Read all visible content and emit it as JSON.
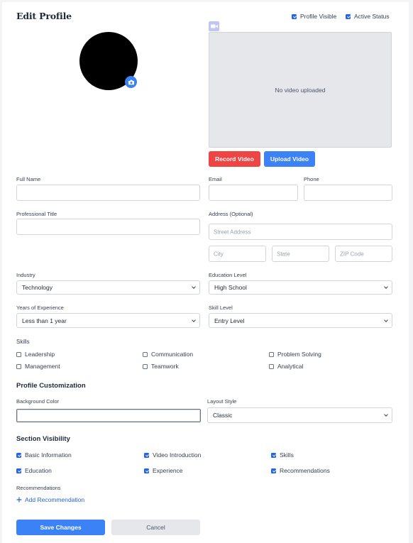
{
  "page": {
    "title": "Edit Profile"
  },
  "status": {
    "profile_visible": "Profile Visible",
    "active_status": "Active Status"
  },
  "video": {
    "empty_text": "No video uploaded",
    "record_label": "Record Video",
    "upload_label": "Upload Video"
  },
  "form": {
    "full_name": {
      "label": "Full Name",
      "value": ""
    },
    "email": {
      "label": "Email",
      "value": ""
    },
    "phone": {
      "label": "Phone",
      "value": ""
    },
    "professional_title": {
      "label": "Professional Title",
      "value": ""
    },
    "address": {
      "label": "Address (Optional)",
      "street_placeholder": "Street Address",
      "city_placeholder": "City",
      "state_placeholder": "State",
      "zip_placeholder": "ZIP Code"
    },
    "industry": {
      "label": "Industry",
      "value": "Technology"
    },
    "education_level": {
      "label": "Education Level",
      "value": "High School"
    },
    "years_experience": {
      "label": "Years of Experience",
      "value": "Less than 1 year"
    },
    "skill_level": {
      "label": "Skill Level",
      "value": "Entry Level"
    }
  },
  "skills": {
    "label": "Skills",
    "items": [
      {
        "label": "Leadership",
        "checked": false
      },
      {
        "label": "Communication",
        "checked": false
      },
      {
        "label": "Problem Solving",
        "checked": false
      },
      {
        "label": "Management",
        "checked": false
      },
      {
        "label": "Teamwork",
        "checked": false
      },
      {
        "label": "Analytical",
        "checked": false
      }
    ]
  },
  "customization": {
    "heading": "Profile Customization",
    "background_color_label": "Background Color",
    "layout_style_label": "Layout Style",
    "layout_style_value": "Classic"
  },
  "visibility": {
    "heading": "Section Visibility",
    "items": [
      {
        "label": "Basic Information",
        "checked": true
      },
      {
        "label": "Video Introduction",
        "checked": true
      },
      {
        "label": "Skills",
        "checked": true
      },
      {
        "label": "Education",
        "checked": true
      },
      {
        "label": "Experience",
        "checked": true
      },
      {
        "label": "Recommendations",
        "checked": true
      }
    ]
  },
  "recommendations": {
    "label": "Recommendations",
    "add_label": "Add Recommendation"
  },
  "actions": {
    "save_label": "Save Changes",
    "cancel_label": "Cancel"
  },
  "colors": {
    "primary": "#3b82f6",
    "danger": "#ef4444",
    "checkbox": "#2563eb",
    "link": "#2563eb"
  },
  "icons": {
    "camera": "camera-icon",
    "video_badge": "video-icon",
    "add": "plus-icon",
    "chevron": "chevron-down-icon"
  }
}
